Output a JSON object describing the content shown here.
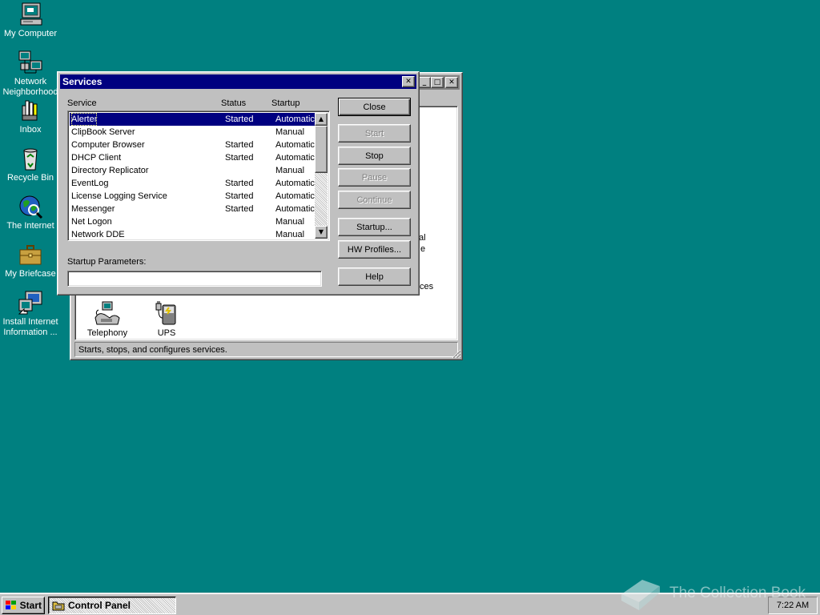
{
  "desktop": {
    "icons": [
      {
        "label": "My Computer",
        "icon": "my-computer-icon"
      },
      {
        "label": "Network Neighborhood",
        "icon": "network-neighborhood-icon"
      },
      {
        "label": "Inbox",
        "icon": "inbox-icon"
      },
      {
        "label": "Recycle Bin",
        "icon": "recycle-bin-icon"
      },
      {
        "label": "The Internet",
        "icon": "internet-icon"
      },
      {
        "label": "My Briefcase",
        "icon": "briefcase-icon"
      },
      {
        "label": "Install Internet Information ...",
        "icon": "install-icon"
      }
    ]
  },
  "control_panel": {
    "status": "Starts, stops, and configures services.",
    "partial_text": [
      "al",
      "e",
      "ces"
    ],
    "items": [
      {
        "label": "Telephony",
        "icon": "telephony-icon"
      },
      {
        "label": "UPS",
        "icon": "ups-icon"
      }
    ]
  },
  "services_dialog": {
    "title": "Services",
    "columns": {
      "service": "Service",
      "status": "Status",
      "startup": "Startup"
    },
    "rows": [
      {
        "name": "Alerter",
        "status": "Started",
        "startup": "Automatic",
        "selected": true
      },
      {
        "name": "ClipBook Server",
        "status": "",
        "startup": "Manual"
      },
      {
        "name": "Computer Browser",
        "status": "Started",
        "startup": "Automatic"
      },
      {
        "name": "DHCP Client",
        "status": "Started",
        "startup": "Automatic"
      },
      {
        "name": "Directory Replicator",
        "status": "",
        "startup": "Manual"
      },
      {
        "name": "EventLog",
        "status": "Started",
        "startup": "Automatic"
      },
      {
        "name": "License Logging Service",
        "status": "Started",
        "startup": "Automatic"
      },
      {
        "name": "Messenger",
        "status": "Started",
        "startup": "Automatic"
      },
      {
        "name": "Net Logon",
        "status": "",
        "startup": "Manual"
      },
      {
        "name": "Network DDE",
        "status": "",
        "startup": "Manual"
      }
    ],
    "buttons": {
      "close": "Close",
      "start": "Start",
      "stop": "Stop",
      "pause": "Pause",
      "continue": "Continue",
      "startup": "Startup...",
      "hw_profiles": "HW Profiles...",
      "help": "Help"
    },
    "startup_params_label": "Startup Parameters:",
    "startup_params_value": ""
  },
  "taskbar": {
    "start_label": "Start",
    "tasks": [
      {
        "label": "Control Panel",
        "active": true
      }
    ],
    "clock": "7:22 AM"
  },
  "watermark": {
    "text": "The Collection Book"
  },
  "colors": {
    "desktop": "#008080",
    "title_active": "#000080",
    "title_inactive": "#808080",
    "face": "#c0c0c0"
  }
}
